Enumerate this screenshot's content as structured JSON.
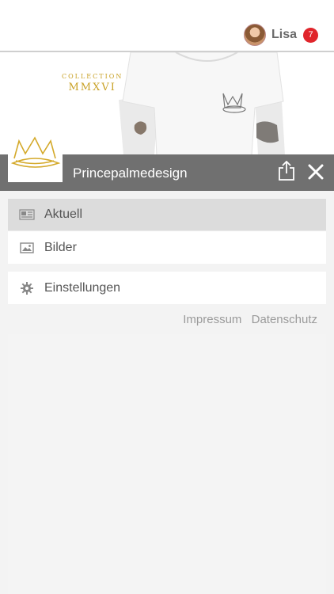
{
  "header": {
    "user_name": "Lisa",
    "notification_count": "7"
  },
  "banner": {
    "collection_word": "COLLECTION",
    "collection_year": "MMXVI"
  },
  "titlebar": {
    "title": "Princepalmedesign"
  },
  "menu": {
    "items": [
      {
        "label": "Aktuell",
        "icon": "news-icon",
        "active": true
      },
      {
        "label": "Bilder",
        "icon": "image-icon",
        "active": false
      }
    ],
    "settings": {
      "label": "Einstellungen",
      "icon": "gear-icon"
    }
  },
  "footer_links": {
    "impressum": "Impressum",
    "datenschutz": "Datenschutz"
  },
  "colors": {
    "titlebar": "#707070",
    "badge": "#e0252b",
    "gold": "#c9a227",
    "active_item": "#dcdcdc"
  }
}
